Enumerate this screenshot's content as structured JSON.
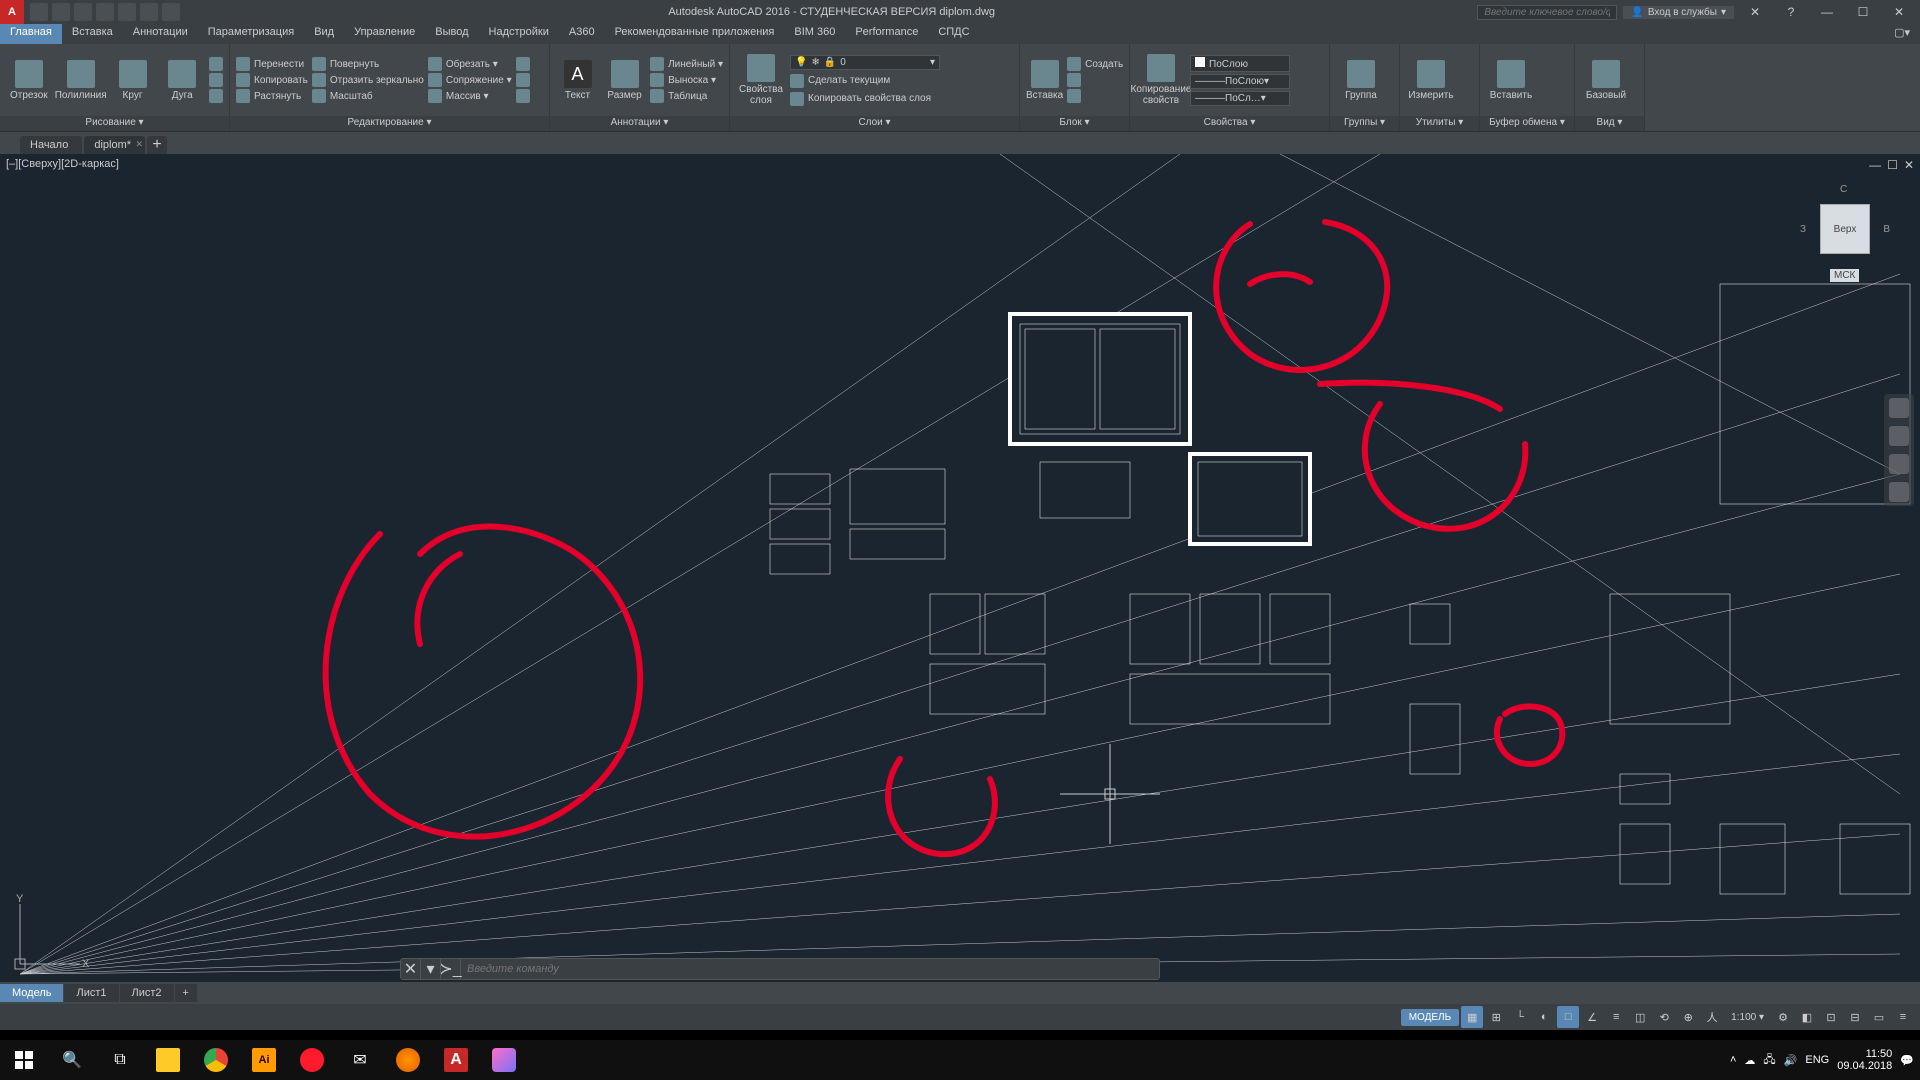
{
  "app": {
    "title": "Autodesk AutoCAD 2016 - СТУДЕНЧЕСКАЯ ВЕРСИЯ   diplom.dwg",
    "search_placeholder": "Введите ключевое слово/фразу",
    "signin": "Вход в службы",
    "help_icon": "?"
  },
  "menus": [
    "Главная",
    "Вставка",
    "Аннотации",
    "Параметризация",
    "Вид",
    "Управление",
    "Вывод",
    "Надстройки",
    "A360",
    "Рекомендованные приложения",
    "BIM 360",
    "Performance",
    "СПДС"
  ],
  "active_menu": 0,
  "ribbon": {
    "draw": {
      "title": "Рисование ▾",
      "items": [
        "Отрезок",
        "Полилиния",
        "Круг",
        "Дуга"
      ]
    },
    "modify": {
      "title": "Редактирование ▾",
      "rows": [
        [
          "Перенести",
          "Повернуть",
          "Обрезать ▾"
        ],
        [
          "Копировать",
          "Отразить зеркально",
          "Сопряжение ▾"
        ],
        [
          "Растянуть",
          "Масштаб",
          "Массив ▾"
        ]
      ]
    },
    "annot": {
      "title": "Аннотации ▾",
      "big": [
        "Текст",
        "Размер"
      ],
      "rows": [
        "Линейный ▾",
        "Выноска ▾",
        "Таблица"
      ]
    },
    "layers": {
      "title": "Слои ▾",
      "big": "Свойства\nслоя",
      "combo": "0",
      "rows": [
        "Сделать текущим",
        "Копировать свойства слоя"
      ]
    },
    "block": {
      "title": "Блок ▾",
      "big": "Вставка",
      "side": "Создать"
    },
    "props": {
      "title": "Свойства ▾",
      "big": "Копирование\nсвойств",
      "combos": [
        "ПоСлою",
        "———ПоСлою▾",
        "———ПоСл…▾"
      ]
    },
    "groups": {
      "title": "Группы ▾",
      "big": "Группа"
    },
    "utils": {
      "title": "Утилиты ▾",
      "big": "Измерить"
    },
    "clip": {
      "title": "Буфер обмена ▾",
      "big": "Вставить"
    },
    "view": {
      "title": "Вид ▾",
      "big": "Базовый"
    }
  },
  "filetabs": [
    "Начало",
    "diplom*"
  ],
  "active_file_tab": 1,
  "viewport_label": "[–][Сверху][2D-каркас]",
  "viewcube": {
    "face": "Верх",
    "n": "С",
    "e": "В",
    "w": "З",
    "wcs": "МСК"
  },
  "cmd": {
    "prompt": "Введите команду"
  },
  "layout_tabs": [
    "Модель",
    "Лист1",
    "Лист2"
  ],
  "status": {
    "model": "МОДЕЛЬ",
    "scale": "1:100 ▾"
  },
  "taskbar": {
    "lang": "ENG",
    "time": "11:50",
    "date": "09.04.2018"
  }
}
